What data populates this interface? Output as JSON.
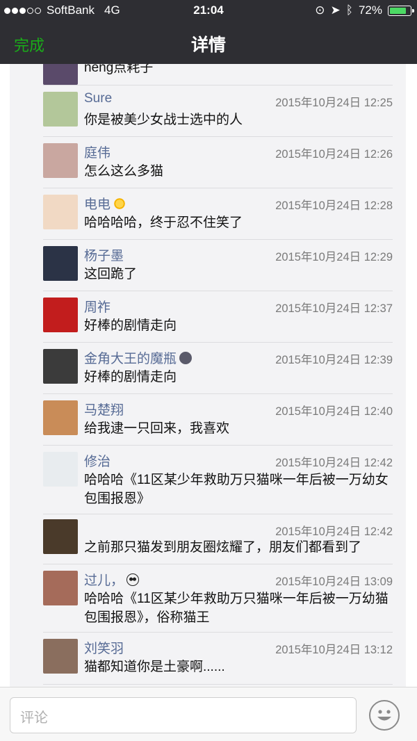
{
  "status_bar": {
    "carrier": "SoftBank",
    "network": "4G",
    "time": "21:04",
    "battery": "72%",
    "battery_level": 0.72
  },
  "nav": {
    "done_label": "完成",
    "title": "详情"
  },
  "partial_comment": {
    "text": "neng点耗子"
  },
  "comments": [
    {
      "name": "Sure",
      "time": "2015年10月24日 12:25",
      "text": "你是被美少女战士选中的人",
      "avatar_color": "#b3c79a"
    },
    {
      "name": "庭伟",
      "time": "2015年10月24日 12:26",
      "text": "怎么这么多猫",
      "avatar_color": "#c9a7a0"
    },
    {
      "name": "电电",
      "time": "2015年10月24日 12:28",
      "text": "哈哈哈哈，终于忍不住笑了",
      "avatar_color": "#f1d9c4",
      "badge": "sun-emoji"
    },
    {
      "name": "杨子墨",
      "time": "2015年10月24日 12:29",
      "text": "这回跪了",
      "avatar_color": "#2b3346"
    },
    {
      "name": "周祚",
      "time": "2015年10月24日 12:37",
      "text": "好棒的剧情走向",
      "avatar_color": "#c21d1d"
    },
    {
      "name": "金角大王的魔瓶",
      "time": "2015年10月24日 12:39",
      "text": "好棒的剧情走向",
      "avatar_color": "#3b3b3b",
      "badge": "moon-emoji"
    },
    {
      "name": "马楚翔",
      "time": "2015年10月24日 12:40",
      "text": "给我逮一只回来，我喜欢",
      "avatar_color": "#c98c58"
    },
    {
      "name": "修治",
      "time": "2015年10月24日 12:42",
      "text": "哈哈哈《11区某少年救助万只猫咪一年后被一万幼女包围报恩》",
      "avatar_color": "#e8ecef"
    },
    {
      "name": "",
      "time": "2015年10月24日 12:42",
      "text": "之前那只猫发到朋友圈炫耀了，朋友们都看到了",
      "avatar_color": "#4a3a2a"
    },
    {
      "name": "过儿，",
      "time": "2015年10月24日 13:09",
      "text": "哈哈哈《11区某少年救助万只猫咪一年后被一万幼猫包围报恩》，俗称猫王",
      "avatar_color": "#a56b5a",
      "badge": "panda-emoji"
    },
    {
      "name": "刘笑羽",
      "time": "2015年10月24日 13:12",
      "text": "猫都知道你是土豪啊......",
      "avatar_color": "#8a6e5e"
    }
  ],
  "input": {
    "placeholder": "评论"
  },
  "colors": {
    "bar": "#2e2e33",
    "accent": "#1aad19",
    "name": "#576b95",
    "feed_bg": "#f3f3f5"
  }
}
